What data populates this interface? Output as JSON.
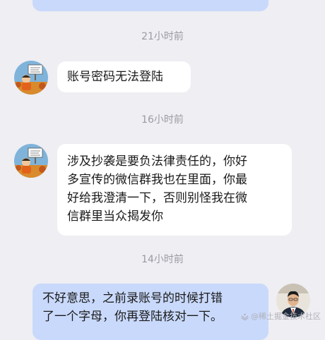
{
  "messages": [
    {
      "id": "m1",
      "direction": "outgoing",
      "text": ""
    },
    {
      "id": "t1",
      "type": "timestamp",
      "text": "21小时前"
    },
    {
      "id": "m2",
      "direction": "incoming",
      "text": "账号密码无法登陆"
    },
    {
      "id": "t2",
      "type": "timestamp",
      "text": "16小时前"
    },
    {
      "id": "m3",
      "direction": "incoming",
      "lines": [
        "涉及抄袭是要负法律责任的，你好",
        "多宣传的微信群我也在里面，你最",
        "好给我澄清一下，否则别怪我在微",
        "信群里当众揭发你"
      ]
    },
    {
      "id": "t3",
      "type": "timestamp",
      "text": "14小时前"
    },
    {
      "id": "m4",
      "direction": "outgoing",
      "lines": [
        "不好意思，之前录账号的时候打错",
        "了一个字母，你再登陆核对一下。"
      ]
    }
  ],
  "watermark": {
    "text": "@稀土掘金技术社区",
    "icon": "juejin-logo-icon"
  },
  "colors": {
    "background": "#EEEEF3",
    "incoming_bubble": "#FFFFFF",
    "outgoing_bubble": "#C9D9FB",
    "timestamp_text": "#9A9AA2"
  }
}
